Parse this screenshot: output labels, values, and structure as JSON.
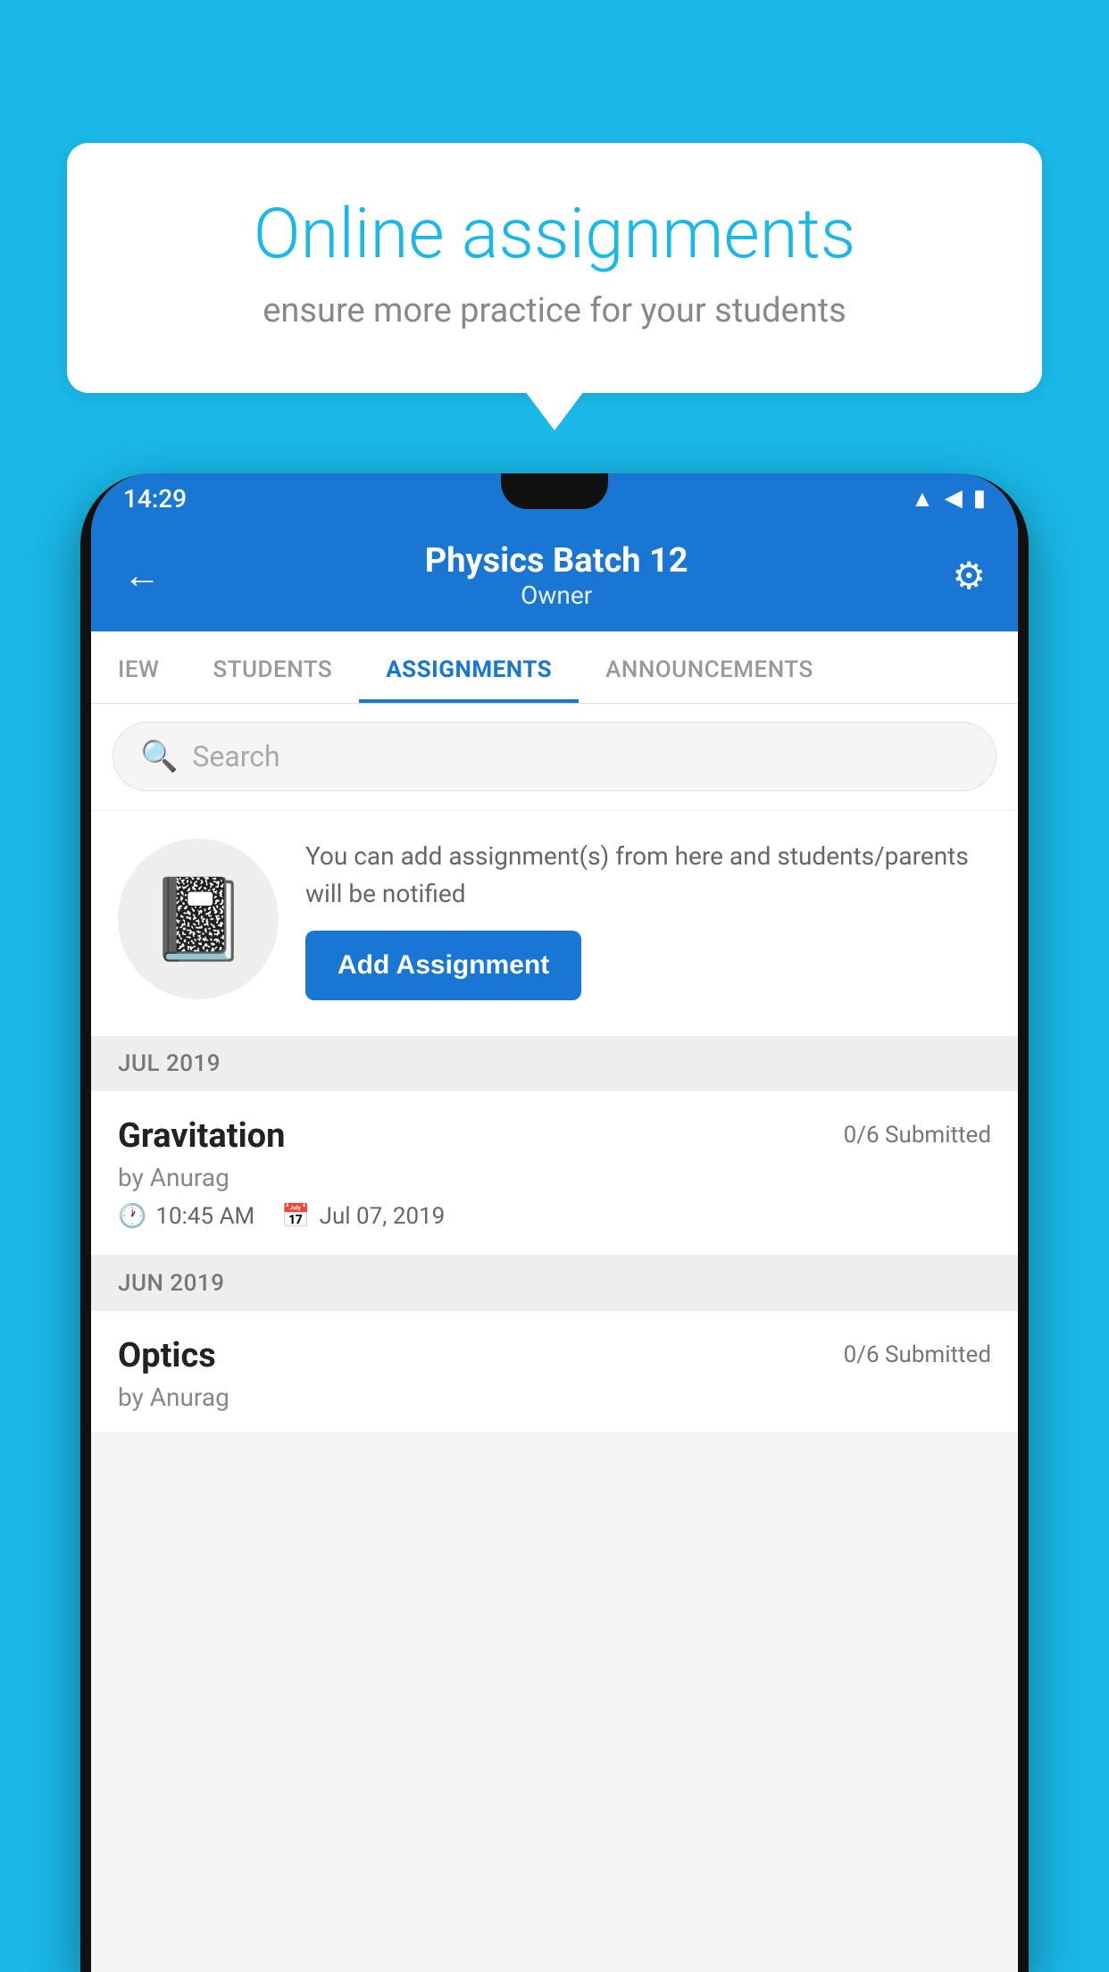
{
  "background_color": "#1ab8e8",
  "speech_bubble": {
    "title": "Online assignments",
    "subtitle": "ensure more practice for your students"
  },
  "status_bar": {
    "time": "14:29",
    "icons": [
      "wifi",
      "signal",
      "battery"
    ]
  },
  "app_header": {
    "title": "Physics Batch 12",
    "subtitle": "Owner",
    "back_label": "←",
    "gear_label": "⚙"
  },
  "tabs": [
    {
      "label": "IEW",
      "active": false
    },
    {
      "label": "STUDENTS",
      "active": false
    },
    {
      "label": "ASSIGNMENTS",
      "active": true
    },
    {
      "label": "ANNOUNCEMENTS",
      "active": false
    }
  ],
  "search": {
    "placeholder": "Search"
  },
  "add_assignment": {
    "description": "You can add assignment(s) from here and students/parents will be notified",
    "button_label": "Add Assignment",
    "icon": "📓"
  },
  "months": [
    {
      "label": "JUL 2019",
      "assignments": [
        {
          "name": "Gravitation",
          "submitted": "0/6 Submitted",
          "by": "by Anurag",
          "time": "10:45 AM",
          "date": "Jul 07, 2019"
        }
      ]
    },
    {
      "label": "JUN 2019",
      "assignments": [
        {
          "name": "Optics",
          "submitted": "0/6 Submitted",
          "by": "by Anurag"
        }
      ]
    }
  ]
}
